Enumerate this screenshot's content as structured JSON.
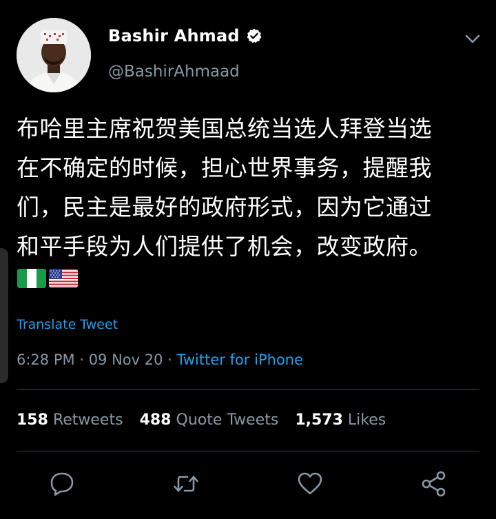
{
  "tweet": {
    "author": {
      "display_name": "Bashir Ahmad",
      "handle": "@BashirAhmaad",
      "verified": true
    },
    "text_lines": [
      "布哈里主席祝贺美国总统当选人拜登当选",
      "在不确定的时候，担心世界事务，提醒我",
      "们，民主是最好的政府形式，因为它通过",
      "和平手段为人们提供了机会，改变政府。"
    ],
    "flags": [
      "🇳🇬",
      "🇺🇸"
    ],
    "translate_label": "Translate Tweet",
    "time": "6:28 PM",
    "date": "09 Nov 20",
    "separator": "·",
    "source": "Twitter for iPhone"
  },
  "stats": {
    "retweets_count": "158",
    "retweets_label": "Retweets",
    "quote_count": "488",
    "quote_label": "Quote Tweets",
    "likes_count": "1,573",
    "likes_label": "Likes"
  },
  "actions": {
    "reply": "reply-icon",
    "retweet": "retweet-icon",
    "like": "heart-icon",
    "share": "share-icon"
  },
  "colors": {
    "background": "#000000",
    "text": "#ffffff",
    "secondary": "#8899a6",
    "link": "#1da1f2",
    "divider": "#38444d",
    "verified_badge": "#ffffff"
  }
}
